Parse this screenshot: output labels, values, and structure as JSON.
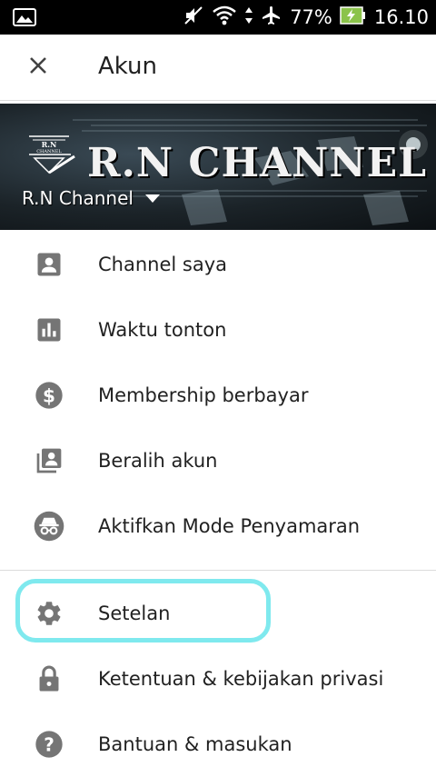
{
  "status_bar": {
    "battery": "77%",
    "time": "16.10"
  },
  "header": {
    "title": "Akun"
  },
  "banner": {
    "channel_art_text": "R.N CHANNEL",
    "logo_text": "R.N CHANNEL",
    "account_name": "R.N Channel"
  },
  "menu": {
    "items": [
      {
        "label": "Channel saya",
        "icon": "account-box-icon"
      },
      {
        "label": "Waktu tonton",
        "icon": "bar-chart-icon"
      },
      {
        "label": "Membership berbayar",
        "icon": "dollar-icon"
      },
      {
        "label": "Beralih akun",
        "icon": "switch-account-icon"
      },
      {
        "label": "Aktifkan Mode Penyamaran",
        "icon": "incognito-icon"
      },
      {
        "label": "Setelan",
        "icon": "gear-icon"
      },
      {
        "label": "Ketentuan & kebijakan privasi",
        "icon": "lock-icon"
      },
      {
        "label": "Bantuan & masukan",
        "icon": "help-icon"
      }
    ]
  },
  "colors": {
    "icon_gray": "#757575",
    "highlight": "#7fe9ee",
    "battery_green": "#8bc34a"
  }
}
